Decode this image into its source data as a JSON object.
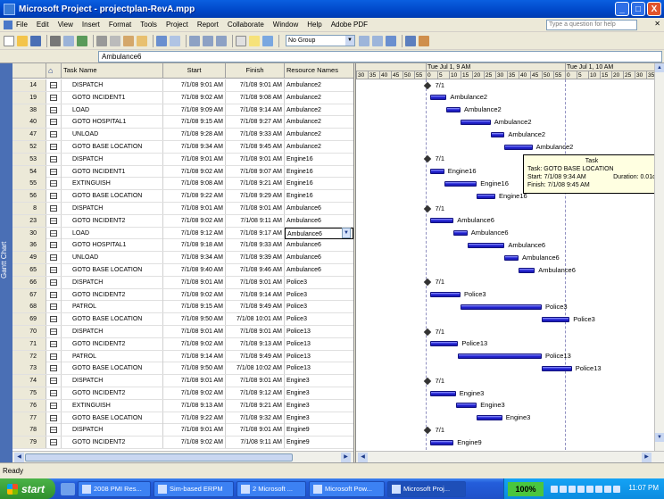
{
  "window": {
    "title": "Microsoft Project - projectplan-RevA.mpp",
    "min": "_",
    "max": "□",
    "close": "X"
  },
  "menu": {
    "items": [
      "File",
      "Edit",
      "View",
      "Insert",
      "Format",
      "Tools",
      "Project",
      "Report",
      "Collaborate",
      "Window",
      "Help",
      "Adobe PDF"
    ],
    "help_placeholder": "Type a question for help",
    "close": "✕"
  },
  "toolbar": {
    "group_value": "No Group"
  },
  "entry": {
    "value": "Ambulance6"
  },
  "view": {
    "label": "Gantt Chart"
  },
  "table": {
    "headers": {
      "id": "",
      "ind": "",
      "name": "Task Name",
      "start": "Start",
      "finish": "Finish",
      "resource": "Resource Names"
    },
    "rows": [
      {
        "id": "14",
        "name": "DISPATCH",
        "start": "7/1/08 9:01 AM",
        "finish": "7/1/08 9:01 AM",
        "res": "Ambulance2"
      },
      {
        "id": "19",
        "name": "GOTO INCIDENT1",
        "start": "7/1/08 9:02 AM",
        "finish": "7/1/08 9:08 AM",
        "res": "Ambulance2"
      },
      {
        "id": "38",
        "name": "LOAD",
        "start": "7/1/08 9:09 AM",
        "finish": "7/1/08 9:14 AM",
        "res": "Ambulance2"
      },
      {
        "id": "40",
        "name": "GOTO HOSPITAL1",
        "start": "7/1/08 9:15 AM",
        "finish": "7/1/08 9:27 AM",
        "res": "Ambulance2"
      },
      {
        "id": "47",
        "name": "UNLOAD",
        "start": "7/1/08 9:28 AM",
        "finish": "7/1/08 9:33 AM",
        "res": "Ambulance2"
      },
      {
        "id": "52",
        "name": "GOTO BASE LOCATION",
        "start": "7/1/08 9:34 AM",
        "finish": "7/1/08 9:45 AM",
        "res": "Ambulance2"
      },
      {
        "id": "53",
        "name": "DISPATCH",
        "start": "7/1/08 9:01 AM",
        "finish": "7/1/08 9:01 AM",
        "res": "Engine16"
      },
      {
        "id": "54",
        "name": "GOTO INCIDENT1",
        "start": "7/1/08 9:02 AM",
        "finish": "7/1/08 9:07 AM",
        "res": "Engine16"
      },
      {
        "id": "55",
        "name": "EXTINGUISH",
        "start": "7/1/08 9:08 AM",
        "finish": "7/1/08 9:21 AM",
        "res": "Engine16"
      },
      {
        "id": "56",
        "name": "GOTO BASE LOCATION",
        "start": "7/1/08 9:22 AM",
        "finish": "7/1/08 9:29 AM",
        "res": "Engine16"
      },
      {
        "id": "8",
        "name": "DISPATCH",
        "start": "7/1/08 9:01 AM",
        "finish": "7/1/08 9:01 AM",
        "res": "Ambulance6"
      },
      {
        "id": "23",
        "name": "GOTO INCIDENT2",
        "start": "7/1/08 9:02 AM",
        "finish": "7/1/08 9:11 AM",
        "res": "Ambulance6"
      },
      {
        "id": "30",
        "name": "LOAD",
        "start": "7/1/08 9:12 AM",
        "finish": "7/1/08 9:17 AM",
        "res": "Ambulance6"
      },
      {
        "id": "36",
        "name": "GOTO HOSPITAL1",
        "start": "7/1/08 9:18 AM",
        "finish": "7/1/08 9:33 AM",
        "res": "Ambulance6"
      },
      {
        "id": "49",
        "name": "UNLOAD",
        "start": "7/1/08 9:34 AM",
        "finish": "7/1/08 9:39 AM",
        "res": "Ambulance6"
      },
      {
        "id": "65",
        "name": "GOTO BASE LOCATION",
        "start": "7/1/08 9:40 AM",
        "finish": "7/1/08 9:46 AM",
        "res": "Ambulance6"
      },
      {
        "id": "66",
        "name": "DISPATCH",
        "start": "7/1/08 9:01 AM",
        "finish": "7/1/08 9:01 AM",
        "res": "Police3"
      },
      {
        "id": "67",
        "name": "GOTO INCIDENT2",
        "start": "7/1/08 9:02 AM",
        "finish": "7/1/08 9:14 AM",
        "res": "Police3"
      },
      {
        "id": "68",
        "name": "PATROL",
        "start": "7/1/08 9:15 AM",
        "finish": "7/1/08 9:49 AM",
        "res": "Police3"
      },
      {
        "id": "69",
        "name": "GOTO BASE LOCATION",
        "start": "7/1/08 9:50 AM",
        "finish": "7/1/08 10:01 AM",
        "res": "Police3"
      },
      {
        "id": "70",
        "name": "DISPATCH",
        "start": "7/1/08 9:01 AM",
        "finish": "7/1/08 9:01 AM",
        "res": "Police13"
      },
      {
        "id": "71",
        "name": "GOTO INCIDENT2",
        "start": "7/1/08 9:02 AM",
        "finish": "7/1/08 9:13 AM",
        "res": "Police13"
      },
      {
        "id": "72",
        "name": "PATROL",
        "start": "7/1/08 9:14 AM",
        "finish": "7/1/08 9:49 AM",
        "res": "Police13"
      },
      {
        "id": "73",
        "name": "GOTO BASE LOCATION",
        "start": "7/1/08 9:50 AM",
        "finish": "7/1/08 10:02 AM",
        "res": "Police13"
      },
      {
        "id": "74",
        "name": "DISPATCH",
        "start": "7/1/08 9:01 AM",
        "finish": "7/1/08 9:01 AM",
        "res": "Engine3"
      },
      {
        "id": "75",
        "name": "GOTO INCIDENT2",
        "start": "7/1/08 9:02 AM",
        "finish": "7/1/08 9:12 AM",
        "res": "Engine3"
      },
      {
        "id": "76",
        "name": "EXTINGUISH",
        "start": "7/1/08 9:13 AM",
        "finish": "7/1/08 9:21 AM",
        "res": "Engine3"
      },
      {
        "id": "77",
        "name": "GOTO BASE LOCATION",
        "start": "7/1/08 9:22 AM",
        "finish": "7/1/08 9:32 AM",
        "res": "Engine3"
      },
      {
        "id": "78",
        "name": "DISPATCH",
        "start": "7/1/08 9:01 AM",
        "finish": "7/1/08 9:01 AM",
        "res": "Engine9"
      },
      {
        "id": "79",
        "name": "GOTO INCIDENT2",
        "start": "7/1/08 9:02 AM",
        "finish": "7/1/08 9:11 AM",
        "res": "Engine9"
      }
    ],
    "selected_row": 12
  },
  "gantt": {
    "date1": "Tue Jul 1, 9 AM",
    "date2": "Tue Jul 1, 10 AM",
    "ticks": [
      "30",
      "35",
      "40",
      "45",
      "50",
      "55",
      "0",
      "5",
      "10",
      "15",
      "20",
      "25",
      "30",
      "35",
      "40",
      "45",
      "50",
      "55",
      "0",
      "5",
      "10",
      "15",
      "20",
      "25",
      "30",
      "35"
    ],
    "milestone_label": "7/1"
  },
  "tooltip": {
    "title": "Task",
    "task": "Task: GOTO BASE LOCATION",
    "start": "Start: 7/1/08 9:34 AM",
    "duration": "Duration: 0.01d",
    "finish": "Finish: 7/1/08 9:45 AM"
  },
  "status": {
    "text": "Ready"
  },
  "taskbar": {
    "start": "start",
    "buttons": [
      "2008 PMI Res...",
      "Sim-based ERPM",
      "2 Microsoft ...",
      "Microsoft Pow...",
      "Microsoft Proj..."
    ],
    "percent": "100%",
    "clock": "11:07 PM"
  }
}
